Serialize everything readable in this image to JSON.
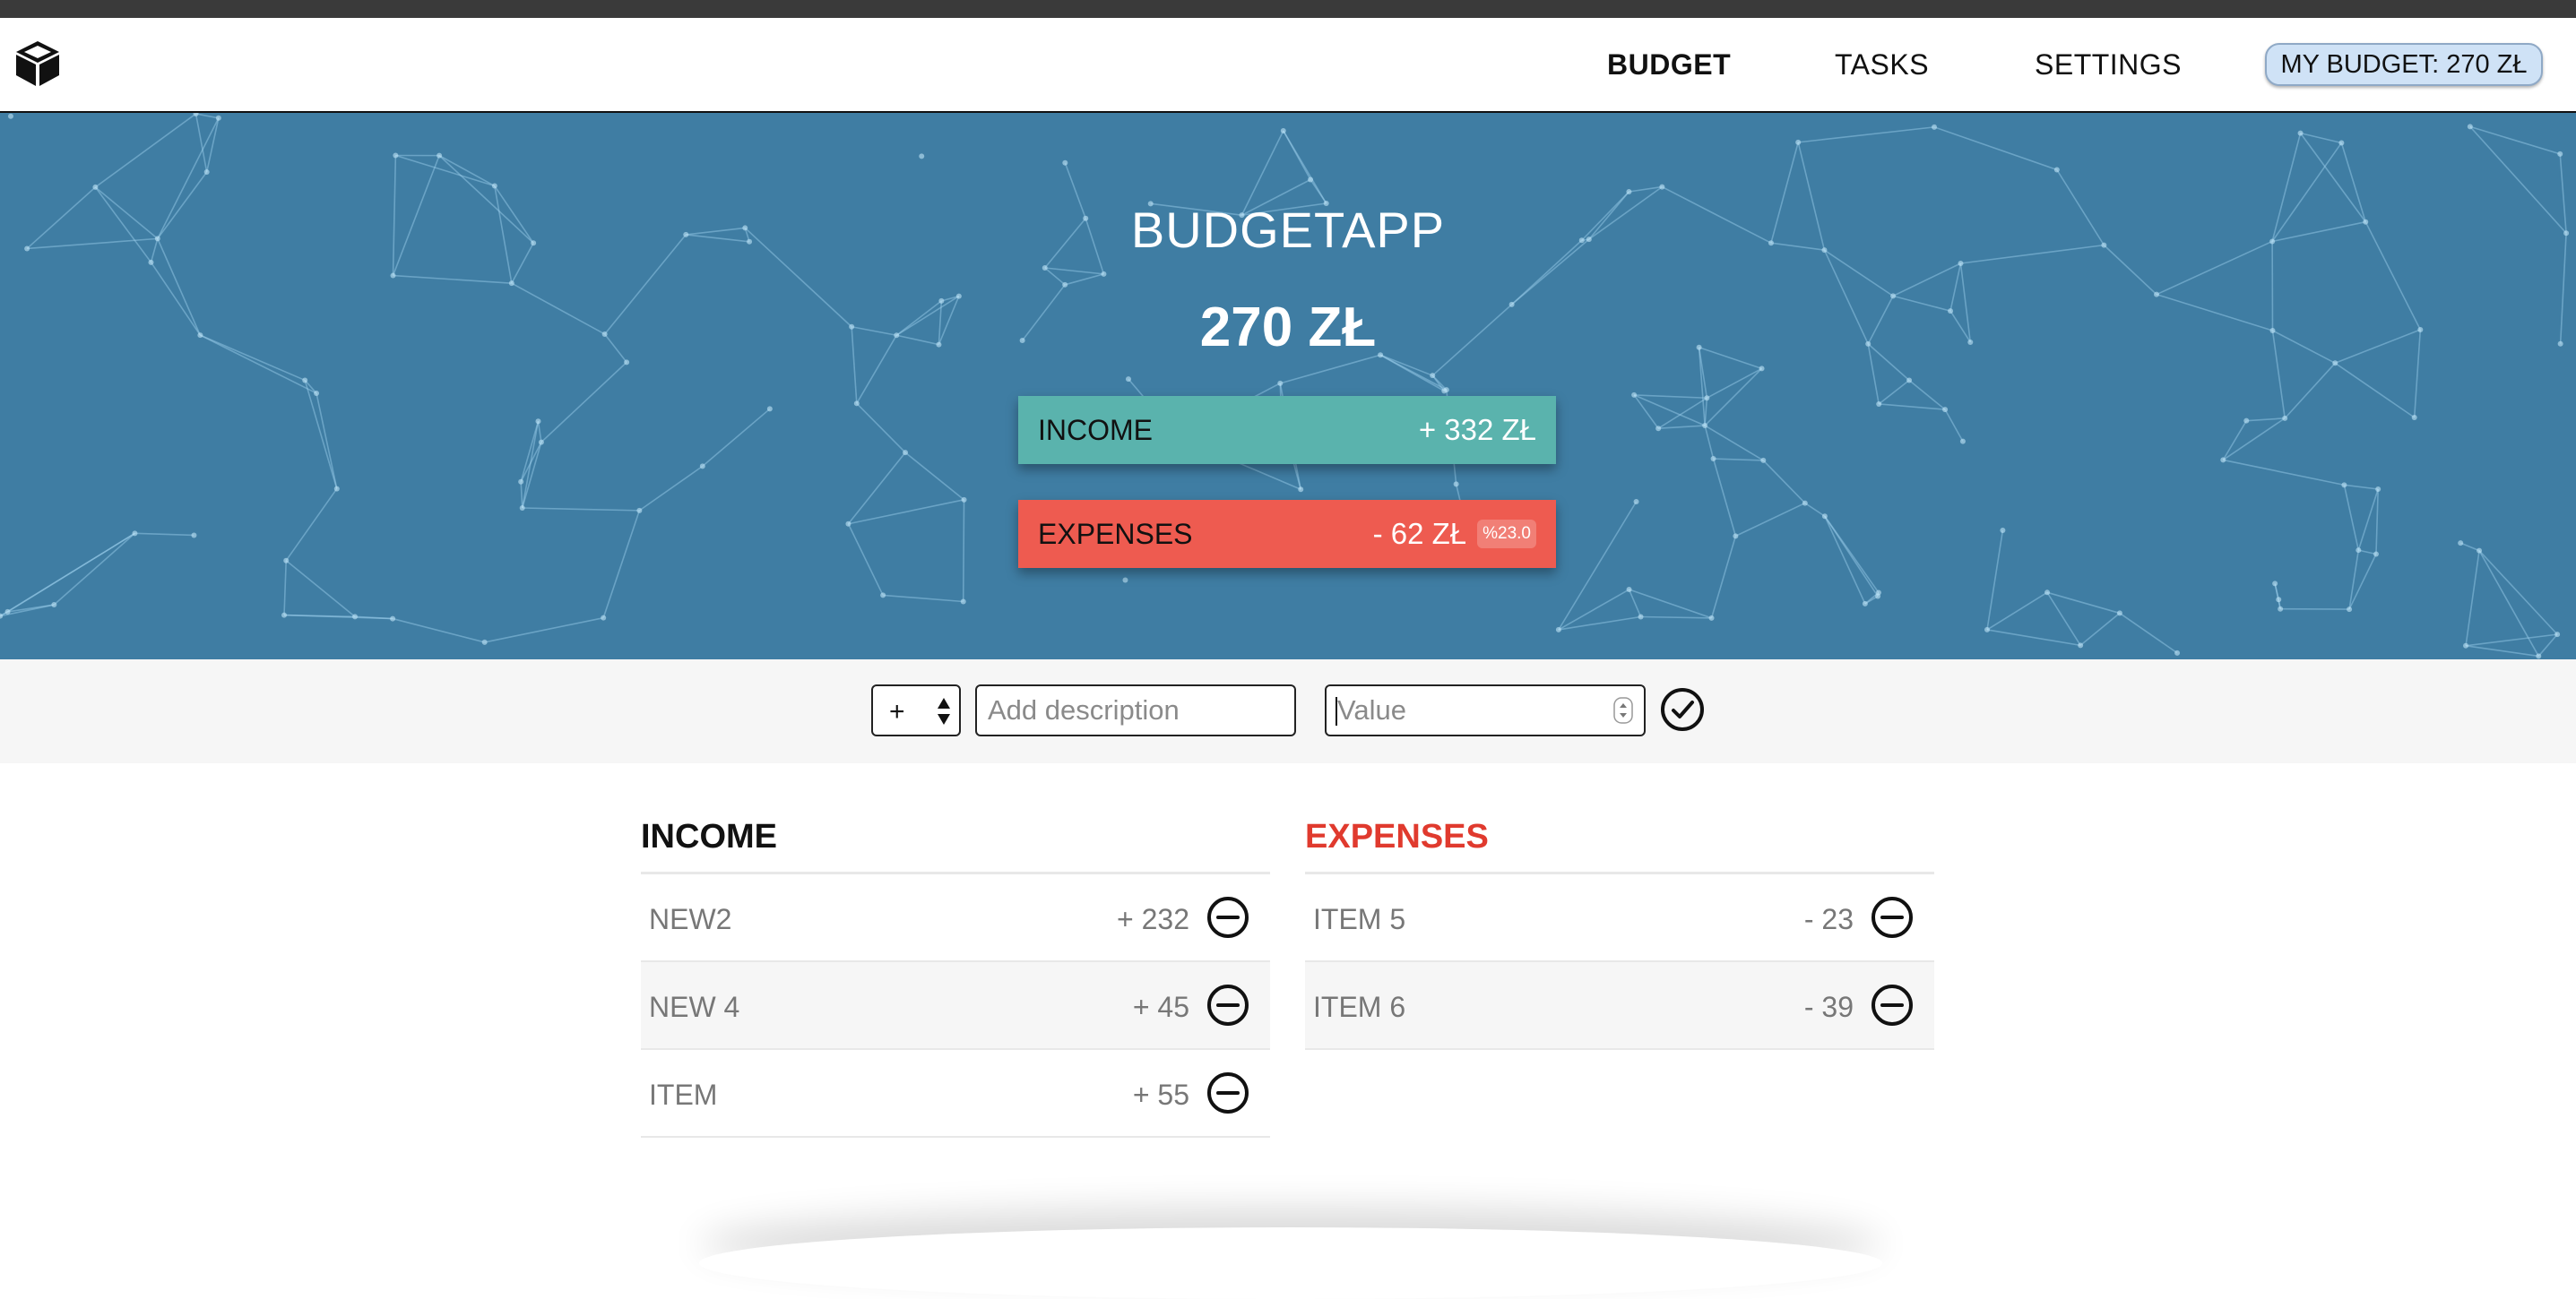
{
  "nav": {
    "logo_icon": "cube-icon",
    "items": [
      {
        "label": "BUDGET",
        "active": true
      },
      {
        "label": "TASKS",
        "active": false
      },
      {
        "label": "SETTINGS",
        "active": false
      }
    ],
    "my_budget": "MY BUDGET: 270 ZŁ"
  },
  "hero": {
    "title": "BUDGETAPP",
    "total": "270 ZŁ",
    "income": {
      "label": "INCOME",
      "value": "+ 332 ZŁ"
    },
    "expenses": {
      "label": "EXPENSES",
      "value": "- 62 ZŁ",
      "percent": "%23.0"
    }
  },
  "add_form": {
    "type_value": "+",
    "description_placeholder": "Add description",
    "value_placeholder": "Value",
    "confirm_icon": "check-circle-icon"
  },
  "income": {
    "heading": "INCOME",
    "items": [
      {
        "description": "NEW2",
        "value": "+ 232"
      },
      {
        "description": "NEW 4",
        "value": "+ 45"
      },
      {
        "description": "ITEM",
        "value": "+ 55"
      }
    ]
  },
  "expenses": {
    "heading": "EXPENSES",
    "items": [
      {
        "description": "ITEM 5",
        "value": "- 23"
      },
      {
        "description": "ITEM 6",
        "value": "- 39"
      }
    ]
  },
  "colors": {
    "hero_bg": "#3f7da3",
    "income_accent": "#5ab3ad",
    "expenses_accent": "#ee5b50",
    "expenses_heading": "#e03a2e"
  }
}
